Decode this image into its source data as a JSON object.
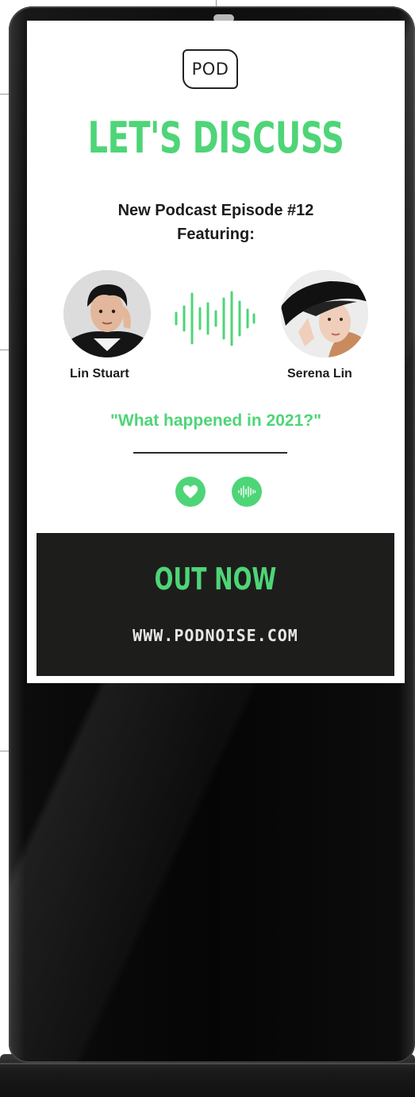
{
  "logo": {
    "text": "POD"
  },
  "headline": "LET'S DISCUSS",
  "subtitle": {
    "line1": "New Podcast Episode #12",
    "line2": "Featuring:"
  },
  "guests": [
    {
      "name": "Lin Stuart"
    },
    {
      "name": "Serena Lin"
    }
  ],
  "quote": "\"What happened in 2021?\"",
  "cta": {
    "title": "OUT NOW",
    "url": "WWW.PODNOISE.COM"
  },
  "icons": {
    "heart": "heart-icon",
    "soundwave": "soundwave-icon"
  },
  "colors": {
    "accent_green": "#4ed577",
    "cta_background": "#1d1e1c",
    "kiosk_body": "#050505"
  }
}
